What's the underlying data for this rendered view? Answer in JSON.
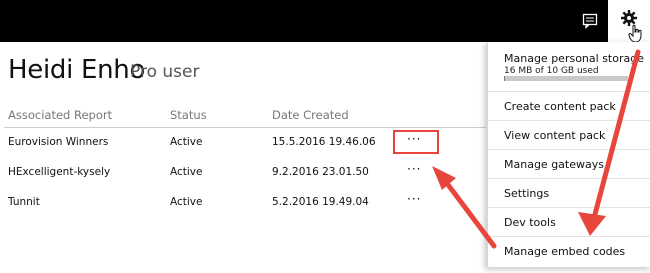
{
  "header": {
    "feedback_icon": "feedback-icon",
    "settings_icon": "gear-icon",
    "cursor_icon": "hand-cursor-icon"
  },
  "user": {
    "name": "Heidi Enho",
    "tier": "Pro user"
  },
  "table": {
    "columns": [
      "Associated Report",
      "Status",
      "Date Created"
    ],
    "rows": [
      {
        "report": "Eurovision Winners",
        "status": "Active",
        "date": "15.5.2016 19.46.06",
        "more": "···"
      },
      {
        "report": "HExcelligent-kysely",
        "status": "Active",
        "date": "9.2.2016 23.01.50",
        "more": "···"
      },
      {
        "report": "Tunnit",
        "status": "Active",
        "date": "5.2.2016 19.49.04",
        "more": "···"
      }
    ]
  },
  "settings_menu": {
    "storage": {
      "label": "Manage personal storage",
      "usage": "16 MB of 10 GB used",
      "used_fraction": 0.0016
    },
    "items": [
      "Create content pack",
      "View content pack",
      "Manage gateways",
      "Settings",
      "Dev tools",
      "Manage embed codes"
    ]
  },
  "colors": {
    "topbar": "#000000",
    "annotation": "#e8463c"
  }
}
